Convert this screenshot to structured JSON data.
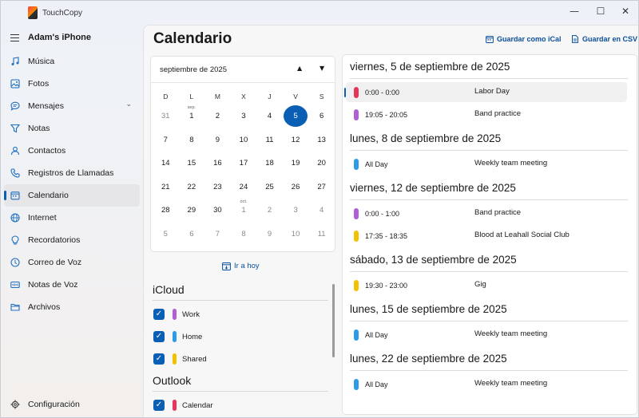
{
  "window": {
    "app_title": "TouchCopy",
    "controls": {
      "minimize": "—",
      "maximize": "☐",
      "close": "✕"
    }
  },
  "sidebar": {
    "device_name": "Adam's iPhone",
    "items": [
      {
        "label": "Música",
        "icon": "music-note-icon"
      },
      {
        "label": "Fotos",
        "icon": "photo-icon"
      },
      {
        "label": "Mensajes",
        "icon": "message-icon",
        "expandable": true
      },
      {
        "label": "Notas",
        "icon": "notes-icon"
      },
      {
        "label": "Contactos",
        "icon": "contact-icon"
      },
      {
        "label": "Registros de Llamadas",
        "icon": "phone-icon"
      },
      {
        "label": "Calendario",
        "icon": "calendar-icon",
        "active": true
      },
      {
        "label": "Internet",
        "icon": "globe-icon"
      },
      {
        "label": "Recordatorios",
        "icon": "bulb-icon"
      },
      {
        "label": "Correo de Voz",
        "icon": "voicemail-icon"
      },
      {
        "label": "Notas de Voz",
        "icon": "voice-note-icon"
      },
      {
        "label": "Archivos",
        "icon": "folder-icon"
      }
    ],
    "settings_label": "Configuración",
    "expand_chevron": "⌄"
  },
  "main": {
    "title": "Calendario",
    "save_ical": "Guardar como iCal",
    "save_csv": "Guardar en CSV"
  },
  "mini_calendar": {
    "month": "septiembre de 2025",
    "prev": "▲",
    "next": "▼",
    "weekdays": [
      "D",
      "L",
      "M",
      "X",
      "J",
      "V",
      "S"
    ],
    "weeks": [
      [
        {
          "d": "31",
          "muted": true
        },
        {
          "d": "1",
          "mon": "sep."
        },
        {
          "d": "2"
        },
        {
          "d": "3"
        },
        {
          "d": "4"
        },
        {
          "d": "5",
          "today": true
        },
        {
          "d": "6"
        }
      ],
      [
        {
          "d": "7"
        },
        {
          "d": "8"
        },
        {
          "d": "9"
        },
        {
          "d": "10"
        },
        {
          "d": "11"
        },
        {
          "d": "12"
        },
        {
          "d": "13"
        }
      ],
      [
        {
          "d": "14"
        },
        {
          "d": "15"
        },
        {
          "d": "16"
        },
        {
          "d": "17"
        },
        {
          "d": "18"
        },
        {
          "d": "19"
        },
        {
          "d": "20"
        }
      ],
      [
        {
          "d": "21"
        },
        {
          "d": "22"
        },
        {
          "d": "23"
        },
        {
          "d": "24"
        },
        {
          "d": "25"
        },
        {
          "d": "26"
        },
        {
          "d": "27"
        }
      ],
      [
        {
          "d": "28"
        },
        {
          "d": "29"
        },
        {
          "d": "30"
        },
        {
          "d": "1",
          "mon": "oct.",
          "muted": true
        },
        {
          "d": "2",
          "muted": true
        },
        {
          "d": "3",
          "muted": true
        },
        {
          "d": "4",
          "muted": true
        }
      ],
      [
        {
          "d": "5",
          "muted": true
        },
        {
          "d": "6",
          "muted": true
        },
        {
          "d": "7",
          "muted": true
        },
        {
          "d": "8",
          "muted": true
        },
        {
          "d": "9",
          "muted": true
        },
        {
          "d": "10",
          "muted": true
        },
        {
          "d": "11",
          "muted": true
        }
      ]
    ],
    "go_today": "Ir a hoy"
  },
  "sources": {
    "icloud": {
      "title": "iCloud",
      "calendars": [
        {
          "label": "Work",
          "color": "#b15fd6"
        },
        {
          "label": "Home",
          "color": "#2d9be8"
        },
        {
          "label": "Shared",
          "color": "#f2c200"
        }
      ]
    },
    "outlook": {
      "title": "Outlook",
      "calendars": [
        {
          "label": "Calendar",
          "color": "#e8335a"
        }
      ]
    },
    "check_glyph": "✓"
  },
  "events": {
    "days": [
      {
        "header": "viernes, 5 de septiembre de 2025",
        "items": [
          {
            "time": "0:00 - 0:00",
            "title": "Labor Day",
            "color": "#e8335a",
            "selected": true
          },
          {
            "time": "19:05 - 20:05",
            "title": "Band practice",
            "color": "#b15fd6"
          }
        ]
      },
      {
        "header": "lunes, 8 de septiembre de 2025",
        "items": [
          {
            "time": "All Day",
            "title": "Weekly team meeting",
            "color": "#2d9be8"
          }
        ]
      },
      {
        "header": "viernes, 12 de septiembre de 2025",
        "items": [
          {
            "time": "0:00 - 1:00",
            "title": "Band practice",
            "color": "#b15fd6"
          },
          {
            "time": "17:35 - 18:35",
            "title": "Blood at Leahall Social Club",
            "color": "#f2c200"
          }
        ]
      },
      {
        "header": "sábado, 13 de septiembre de 2025",
        "items": [
          {
            "time": "19:30 - 23:00",
            "title": "Gig",
            "color": "#f2c200"
          }
        ]
      },
      {
        "header": "lunes, 15 de septiembre de 2025",
        "items": [
          {
            "time": "All Day",
            "title": "Weekly team meeting",
            "color": "#2d9be8"
          }
        ]
      },
      {
        "header": "lunes, 22 de septiembre de 2025",
        "items": [
          {
            "time": "All Day",
            "title": "Weekly team meeting",
            "color": "#2d9be8"
          }
        ]
      }
    ]
  }
}
